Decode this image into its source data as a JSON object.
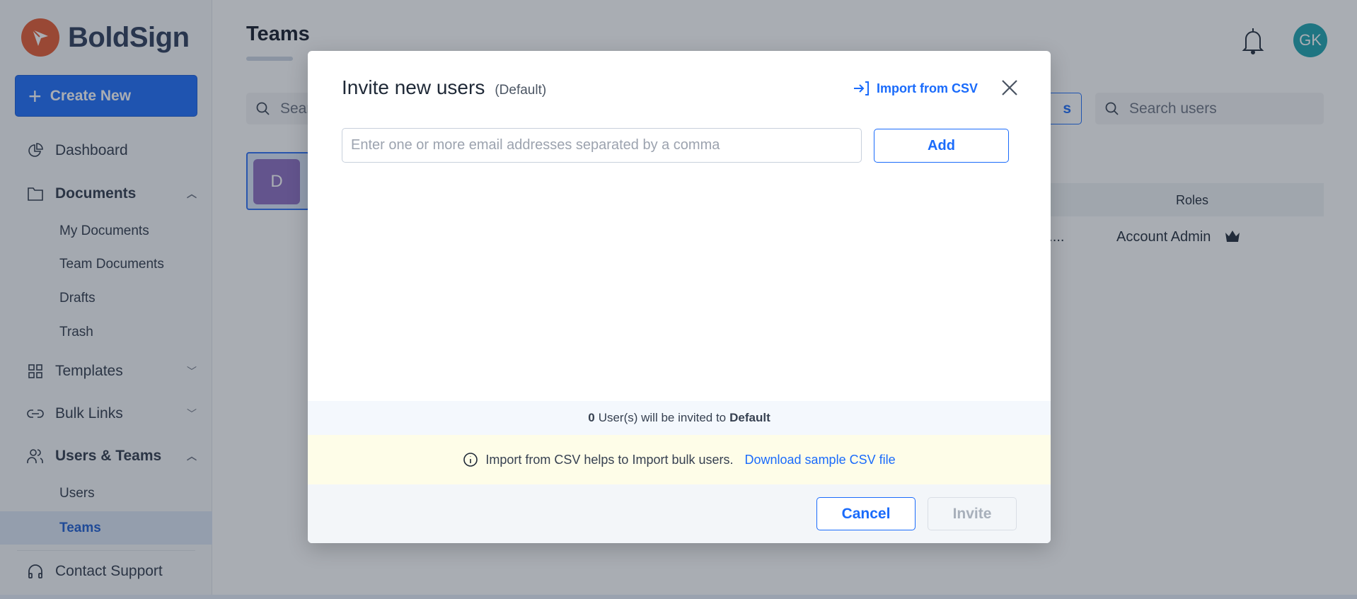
{
  "brand": {
    "name": "BoldSign",
    "color": "#e4572e"
  },
  "sidebar": {
    "create_label": "Create New",
    "items": [
      {
        "label": "Dashboard",
        "icon": "pie-chart-icon"
      },
      {
        "label": "Documents",
        "icon": "folder-icon",
        "expanded": true,
        "children": [
          "My Documents",
          "Team Documents",
          "Drafts",
          "Trash"
        ]
      },
      {
        "label": "Templates",
        "icon": "grid-icon",
        "expanded": false
      },
      {
        "label": "Bulk Links",
        "icon": "link-icon",
        "expanded": false
      },
      {
        "label": "Users & Teams",
        "icon": "users-icon",
        "expanded": true,
        "children": [
          "Users",
          "Teams"
        ]
      },
      {
        "label": "Contact Support",
        "icon": "headset-icon"
      }
    ],
    "active": "Teams"
  },
  "header": {
    "title": "Teams",
    "avatar_initials": "GK"
  },
  "main": {
    "search_placeholder": "Search",
    "button_partial": "s",
    "search_users_placeholder": "Search users",
    "team_initial": "D",
    "table": {
      "headers": [
        "Roles"
      ],
      "rows": [
        {
          "truncated": "on....",
          "role": "Account Admin"
        }
      ]
    }
  },
  "modal": {
    "title": "Invite new users",
    "subtitle": "(Default)",
    "import_label": "Import from CSV",
    "email_placeholder": "Enter one or more email addresses separated by a comma",
    "add_label": "Add",
    "count": "0",
    "count_text": "User(s) will be invited to",
    "team_name": "Default",
    "info_text": "Import from CSV helps to Import bulk users.",
    "download_link": "Download sample CSV file",
    "cancel_label": "Cancel",
    "invite_label": "Invite"
  },
  "colors": {
    "accent": "#1a6bfb",
    "avatar": "#19a2ad",
    "team": "#8a6cc0"
  }
}
